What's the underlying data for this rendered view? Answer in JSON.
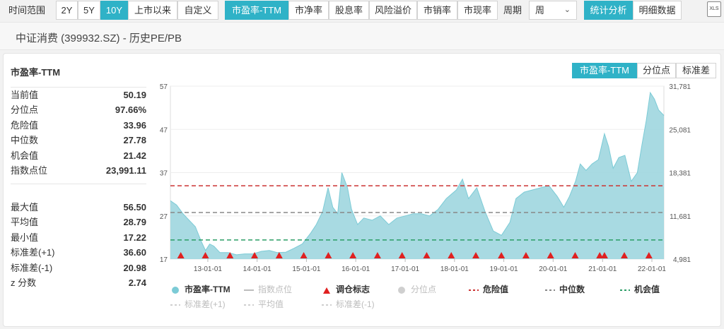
{
  "topbar": {
    "range_label": "时间范围",
    "range_buttons": [
      "2Y",
      "5Y",
      "10Y",
      "上市以来",
      "自定义"
    ],
    "range_active": 2,
    "metric_buttons": [
      "市盈率-TTM",
      "市净率",
      "股息率",
      "风险溢价",
      "市销率",
      "市现率"
    ],
    "metric_active": 0,
    "period_label": "周期",
    "period_value": "周",
    "view_buttons": [
      "统计分析",
      "明细数据"
    ],
    "view_active": 0,
    "export_label": "XLS"
  },
  "page_title": "中证消费 (399932.SZ) - 历史PE/PB",
  "card_title": "市盈率-TTM",
  "right_tabs": [
    "市盈率-TTM",
    "分位点",
    "标准差"
  ],
  "right_tabs_active": 0,
  "stats_group1": [
    {
      "label": "当前值",
      "value": "50.19"
    },
    {
      "label": "分位点",
      "value": "97.66%"
    },
    {
      "label": "危险值",
      "value": "33.96"
    },
    {
      "label": "中位数",
      "value": "27.78"
    },
    {
      "label": "机会值",
      "value": "21.42"
    },
    {
      "label": "指数点位",
      "value": "23,991.11"
    }
  ],
  "stats_group2": [
    {
      "label": "最大值",
      "value": "56.50"
    },
    {
      "label": "平均值",
      "value": "28.79"
    },
    {
      "label": "最小值",
      "value": "17.22"
    },
    {
      "label": "标准差(+1)",
      "value": "36.60"
    },
    {
      "label": "标准差(-1)",
      "value": "20.98"
    },
    {
      "label": "z 分数",
      "value": "2.74"
    }
  ],
  "colors": {
    "accent": "#2fb2c7",
    "area_fill": "#99d4dd",
    "area_line": "#7ccbd6",
    "danger": "#cc3333",
    "median": "#888888",
    "opportunity": "#2a9d66",
    "marker": "#e02020"
  },
  "chart_data": {
    "type": "area",
    "title": "",
    "xlabel": "",
    "ylabel": "",
    "ylim": [
      17,
      57
    ],
    "y_ticks": [
      "57",
      "47",
      "37",
      "27",
      "17"
    ],
    "y2lim": [
      4981,
      31781
    ],
    "y2_ticks": [
      "31,781",
      "25,081",
      "18,381",
      "11,681",
      "4,981"
    ],
    "x_ticks": [
      "13-01-01",
      "14-01-01",
      "15-01-01",
      "16-01-01",
      "17-01-01",
      "18-01-01",
      "19-01-01",
      "20-01-01",
      "21-01-01",
      "22-01-01"
    ],
    "x_range": [
      "2012-03-30",
      "2022-03-31"
    ],
    "grid": true,
    "series": [
      {
        "name": "市盈率-TTM",
        "points": [
          [
            "2012-03-30",
            30.5
          ],
          [
            "2012-05-15",
            29.5
          ],
          [
            "2012-07-01",
            27.5
          ],
          [
            "2012-08-15",
            26.0
          ],
          [
            "2012-10-01",
            24.5
          ],
          [
            "2012-11-15",
            21.0
          ],
          [
            "2012-12-15",
            19.0
          ],
          [
            "2013-01-15",
            20.5
          ],
          [
            "2013-02-15",
            20.0
          ],
          [
            "2013-04-01",
            18.5
          ],
          [
            "2013-06-01",
            18.5
          ],
          [
            "2013-08-01",
            18.0
          ],
          [
            "2013-10-01",
            18.2
          ],
          [
            "2013-12-01",
            18.2
          ],
          [
            "2014-02-01",
            18.8
          ],
          [
            "2014-04-01",
            19.0
          ],
          [
            "2014-06-01",
            18.5
          ],
          [
            "2014-08-01",
            18.6
          ],
          [
            "2014-10-01",
            19.5
          ],
          [
            "2014-12-01",
            20.5
          ],
          [
            "2015-02-01",
            23.0
          ],
          [
            "2015-03-15",
            25.0
          ],
          [
            "2015-05-01",
            28.0
          ],
          [
            "2015-06-10",
            33.5
          ],
          [
            "2015-07-15",
            29.0
          ],
          [
            "2015-08-20",
            27.5
          ],
          [
            "2015-09-20",
            37.0
          ],
          [
            "2015-11-01",
            33.5
          ],
          [
            "2015-12-01",
            28.5
          ],
          [
            "2016-01-15",
            25.0
          ],
          [
            "2016-03-01",
            26.5
          ],
          [
            "2016-05-01",
            26.0
          ],
          [
            "2016-07-01",
            27.0
          ],
          [
            "2016-09-01",
            25.0
          ],
          [
            "2016-11-01",
            26.5
          ],
          [
            "2017-01-01",
            27.0
          ],
          [
            "2017-03-01",
            27.5
          ],
          [
            "2017-05-01",
            27.5
          ],
          [
            "2017-07-01",
            27.0
          ],
          [
            "2017-09-01",
            28.5
          ],
          [
            "2017-11-01",
            31.0
          ],
          [
            "2018-01-15",
            33.0
          ],
          [
            "2018-03-01",
            35.5
          ],
          [
            "2018-04-15",
            31.0
          ],
          [
            "2018-06-15",
            33.5
          ],
          [
            "2018-08-15",
            28.0
          ],
          [
            "2018-10-15",
            23.5
          ],
          [
            "2018-12-15",
            22.5
          ],
          [
            "2019-02-15",
            25.5
          ],
          [
            "2019-04-01",
            31.0
          ],
          [
            "2019-06-01",
            32.5
          ],
          [
            "2019-08-01",
            33.0
          ],
          [
            "2019-10-01",
            33.5
          ],
          [
            "2019-12-01",
            34.0
          ],
          [
            "2020-02-01",
            31.5
          ],
          [
            "2020-03-20",
            29.0
          ],
          [
            "2020-05-01",
            31.5
          ],
          [
            "2020-06-15",
            35.0
          ],
          [
            "2020-07-20",
            39.0
          ],
          [
            "2020-09-01",
            37.5
          ],
          [
            "2020-10-15",
            39.0
          ],
          [
            "2020-12-01",
            40.0
          ],
          [
            "2021-01-15",
            46.0
          ],
          [
            "2021-02-15",
            43.0
          ],
          [
            "2021-03-20",
            38.0
          ],
          [
            "2021-05-01",
            40.5
          ],
          [
            "2021-06-15",
            41.0
          ],
          [
            "2021-08-01",
            35.0
          ],
          [
            "2021-09-15",
            37.0
          ],
          [
            "2021-10-20",
            43.5
          ],
          [
            "2021-11-20",
            49.0
          ],
          [
            "2021-12-20",
            55.5
          ],
          [
            "2022-01-20",
            54.0
          ],
          [
            "2022-02-20",
            51.5
          ],
          [
            "2022-03-31",
            50.2
          ]
        ]
      }
    ],
    "reference_lines": [
      {
        "name": "危险值",
        "value": 33.96
      },
      {
        "name": "中位数",
        "value": 27.78
      },
      {
        "name": "机会值",
        "value": 21.42
      }
    ],
    "rebalance_markers": [
      "2012-06-15",
      "2012-12-14",
      "2013-06-14",
      "2013-12-13",
      "2014-06-13",
      "2014-12-12",
      "2015-06-12",
      "2015-12-11",
      "2016-06-10",
      "2016-12-09",
      "2017-06-09",
      "2017-12-08",
      "2018-06-08",
      "2018-12-14",
      "2019-06-14",
      "2019-12-13",
      "2020-06-12",
      "2020-12-11",
      "2021-01-15",
      "2021-06-11",
      "2021-12-10"
    ]
  },
  "legend": [
    {
      "label": "市盈率-TTM",
      "kind": "dot",
      "color": "#7ccbd6",
      "state": "on"
    },
    {
      "label": "指数点位",
      "kind": "line",
      "color": "#bdbdbd",
      "state": "dim"
    },
    {
      "label": "调仓标志",
      "kind": "triangle",
      "color": "#e02020",
      "state": "on"
    },
    {
      "label": "分位点",
      "kind": "dot",
      "color": "#cfcfcf",
      "state": "dim"
    },
    {
      "label": "危险值",
      "kind": "dash",
      "color": "#cc3333",
      "state": "on"
    },
    {
      "label": "中位数",
      "kind": "dash",
      "color": "#888888",
      "state": "on"
    },
    {
      "label": "机会值",
      "kind": "dash",
      "color": "#2a9d66",
      "state": "on"
    },
    {
      "label": "标准差(+1)",
      "kind": "dash",
      "color": "#cfcfcf",
      "state": "dim"
    },
    {
      "label": "平均值",
      "kind": "dash",
      "color": "#cfcfcf",
      "state": "dim"
    },
    {
      "label": "标准差(-1)",
      "kind": "dash",
      "color": "#cfcfcf",
      "state": "dim"
    }
  ]
}
